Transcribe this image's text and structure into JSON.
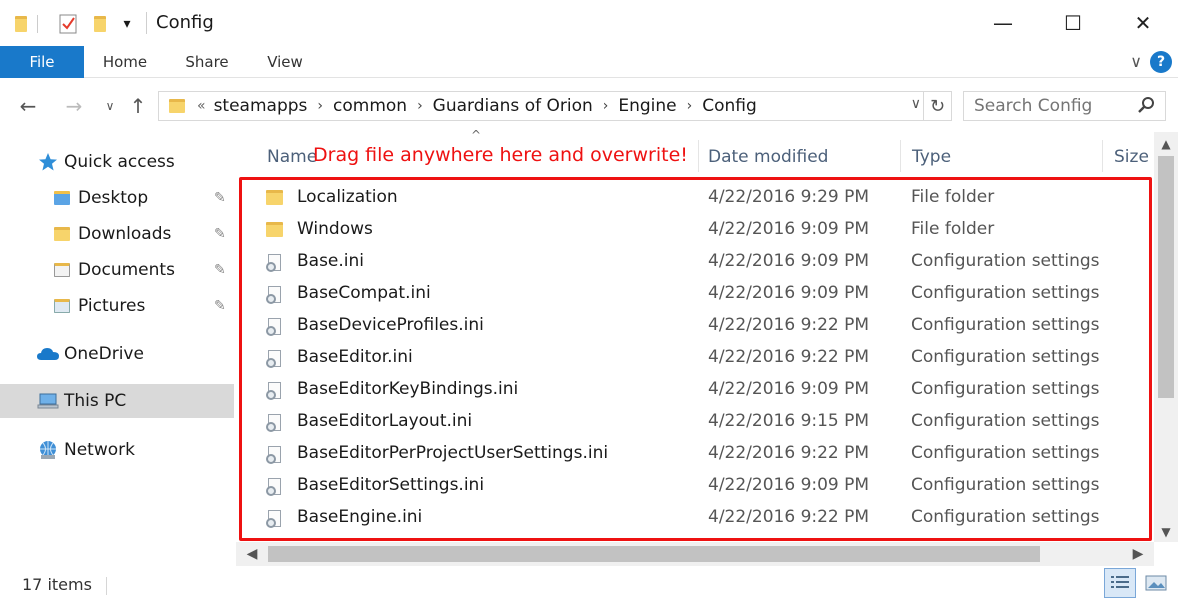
{
  "window": {
    "title": "Config",
    "controls": {
      "minimize": "—",
      "maximize": "☐",
      "close": "✕"
    },
    "qat_dropdown": "▾"
  },
  "ribbon": {
    "tabs": [
      "File",
      "Home",
      "Share",
      "View"
    ],
    "expand": "∨",
    "help": "?"
  },
  "nav": {
    "back": "←",
    "forward": "→",
    "recent": "∨",
    "up": "↑",
    "breadcrumb_overflow": "«",
    "breadcrumb": [
      "steamapps",
      "common",
      "Guardians of Orion",
      "Engine",
      "Config"
    ],
    "breadcrumb_separator": "›",
    "address_dropdown": "∨",
    "refresh": "↻",
    "search_placeholder": "Search Config"
  },
  "sidebar": {
    "items": [
      {
        "label": "Quick access",
        "icon": "star-icon"
      },
      {
        "label": "Desktop",
        "icon": "desktop-folder-icon",
        "pinned": true
      },
      {
        "label": "Downloads",
        "icon": "downloads-folder-icon",
        "pinned": true
      },
      {
        "label": "Documents",
        "icon": "documents-folder-icon",
        "pinned": true
      },
      {
        "label": "Pictures",
        "icon": "pictures-folder-icon",
        "pinned": true
      },
      {
        "label": "OneDrive",
        "icon": "cloud-icon"
      },
      {
        "label": "This PC",
        "icon": "computer-icon",
        "selected": true
      },
      {
        "label": "Network",
        "icon": "network-icon"
      }
    ]
  },
  "file_list": {
    "columns": [
      "Name",
      "Date modified",
      "Type",
      "Size"
    ],
    "sort_indicator": "^",
    "annotation": "Drag file anywhere here and overwrite!",
    "annotation_color": "#ee1111",
    "rows": [
      {
        "name": "Localization",
        "date": "4/22/2016 9:29 PM",
        "type": "File folder",
        "icon": "folder-icon"
      },
      {
        "name": "Windows",
        "date": "4/22/2016 9:09 PM",
        "type": "File folder",
        "icon": "folder-icon"
      },
      {
        "name": "Base.ini",
        "date": "4/22/2016 9:09 PM",
        "type": "Configuration settings",
        "icon": "ini-file-icon"
      },
      {
        "name": "BaseCompat.ini",
        "date": "4/22/2016 9:09 PM",
        "type": "Configuration settings",
        "icon": "ini-file-icon"
      },
      {
        "name": "BaseDeviceProfiles.ini",
        "date": "4/22/2016 9:22 PM",
        "type": "Configuration settings",
        "icon": "ini-file-icon"
      },
      {
        "name": "BaseEditor.ini",
        "date": "4/22/2016 9:22 PM",
        "type": "Configuration settings",
        "icon": "ini-file-icon"
      },
      {
        "name": "BaseEditorKeyBindings.ini",
        "date": "4/22/2016 9:09 PM",
        "type": "Configuration settings",
        "icon": "ini-file-icon"
      },
      {
        "name": "BaseEditorLayout.ini",
        "date": "4/22/2016 9:15 PM",
        "type": "Configuration settings",
        "icon": "ini-file-icon"
      },
      {
        "name": "BaseEditorPerProjectUserSettings.ini",
        "date": "4/22/2016 9:22 PM",
        "type": "Configuration settings",
        "icon": "ini-file-icon"
      },
      {
        "name": "BaseEditorSettings.ini",
        "date": "4/22/2016 9:09 PM",
        "type": "Configuration settings",
        "icon": "ini-file-icon"
      },
      {
        "name": "BaseEngine.ini",
        "date": "4/22/2016 9:22 PM",
        "type": "Configuration settings",
        "icon": "ini-file-icon"
      }
    ]
  },
  "status": {
    "item_count": "17 items"
  },
  "colors": {
    "accent": "#1979ca",
    "selected_bg": "#d9d9d9",
    "header_text": "#4c607a"
  }
}
